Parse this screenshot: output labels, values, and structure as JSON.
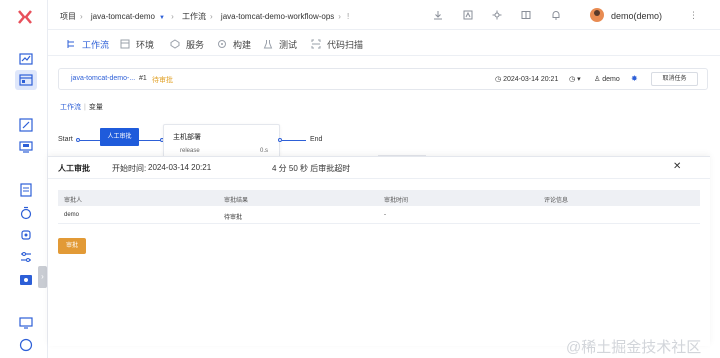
{
  "topbar": {
    "breadcrumbs": [
      "项目",
      "java-tomcat-demo",
      "工作流",
      "java-tomcat-demo-workflow-ops"
    ],
    "user_name": "demo(demo)"
  },
  "tabs": [
    "工作流",
    "环境",
    "服务",
    "构建",
    "测试",
    "代码扫描"
  ],
  "run": {
    "name": "java-tomcat-demo-...",
    "number": "#1",
    "status": "待审批",
    "time": "2024-03-14 20:21",
    "user": "demo",
    "cancel_label": "取消任务"
  },
  "sub_tabs": [
    "工作流",
    "变量"
  ],
  "workflow": {
    "start": "Start",
    "end": "End",
    "approve_node": "人工审批",
    "stage_title": "主机部署",
    "stage_item": "release"
  },
  "approval": {
    "title": "人工审批",
    "start_label": "开始时间:",
    "start_time": "2024-03-14 20:21",
    "timeout": "4 分 50 秒 后审批超时",
    "columns": [
      "审批人",
      "审批结果",
      "审批时间",
      "评论信息"
    ],
    "rows": [
      {
        "approver": "demo",
        "result": "待审批",
        "time": "-",
        "comment": ""
      }
    ],
    "approve_label": "审批"
  },
  "watermark": "@稀土掘金技术社区",
  "colors": {
    "primary": "#2d5fd7",
    "pending": "#e2a32b",
    "approve": "#e29a36"
  }
}
